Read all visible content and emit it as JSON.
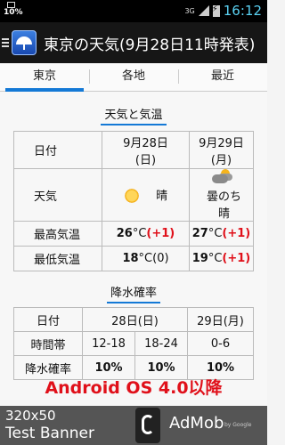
{
  "status": {
    "battery_pct": "10%",
    "network": "3G",
    "time": "16:12"
  },
  "header": {
    "title": "東京の天気(9月28日11時発表)"
  },
  "tabs": [
    "東京",
    "各地",
    "最近"
  ],
  "weather": {
    "section_title": "天気と気温",
    "date_label": "日付",
    "day1": {
      "date": "9月28日",
      "weekday": "(日)",
      "weather": "晴",
      "high": "26",
      "high_diff": "(+1)",
      "low": "18",
      "low_diff": "(0)"
    },
    "day2": {
      "date": "9月29日",
      "weekday": "(月)",
      "weather_l1": "曇のち",
      "weather_l2": "晴",
      "high": "27",
      "high_diff": "(+1)",
      "low": "19",
      "low_diff": "(+1)"
    },
    "weather_label": "天気",
    "high_label": "最高気温",
    "low_label": "最低気温",
    "unit": "°C"
  },
  "precip": {
    "section_title": "降水確率",
    "date_label": "日付",
    "day1": "28日(日)",
    "day2": "29日(月)",
    "time_label": "時間帯",
    "periods": [
      "12-18",
      "18-24",
      "0-6"
    ],
    "prob_label": "降水確率",
    "probs": [
      "10%",
      "10%",
      "10%"
    ]
  },
  "promo_text": "Android OS 4.0以降",
  "ad": {
    "line1": "320x50",
    "line2": "Test Banner",
    "brand": "AdMob",
    "by": "by Google"
  }
}
